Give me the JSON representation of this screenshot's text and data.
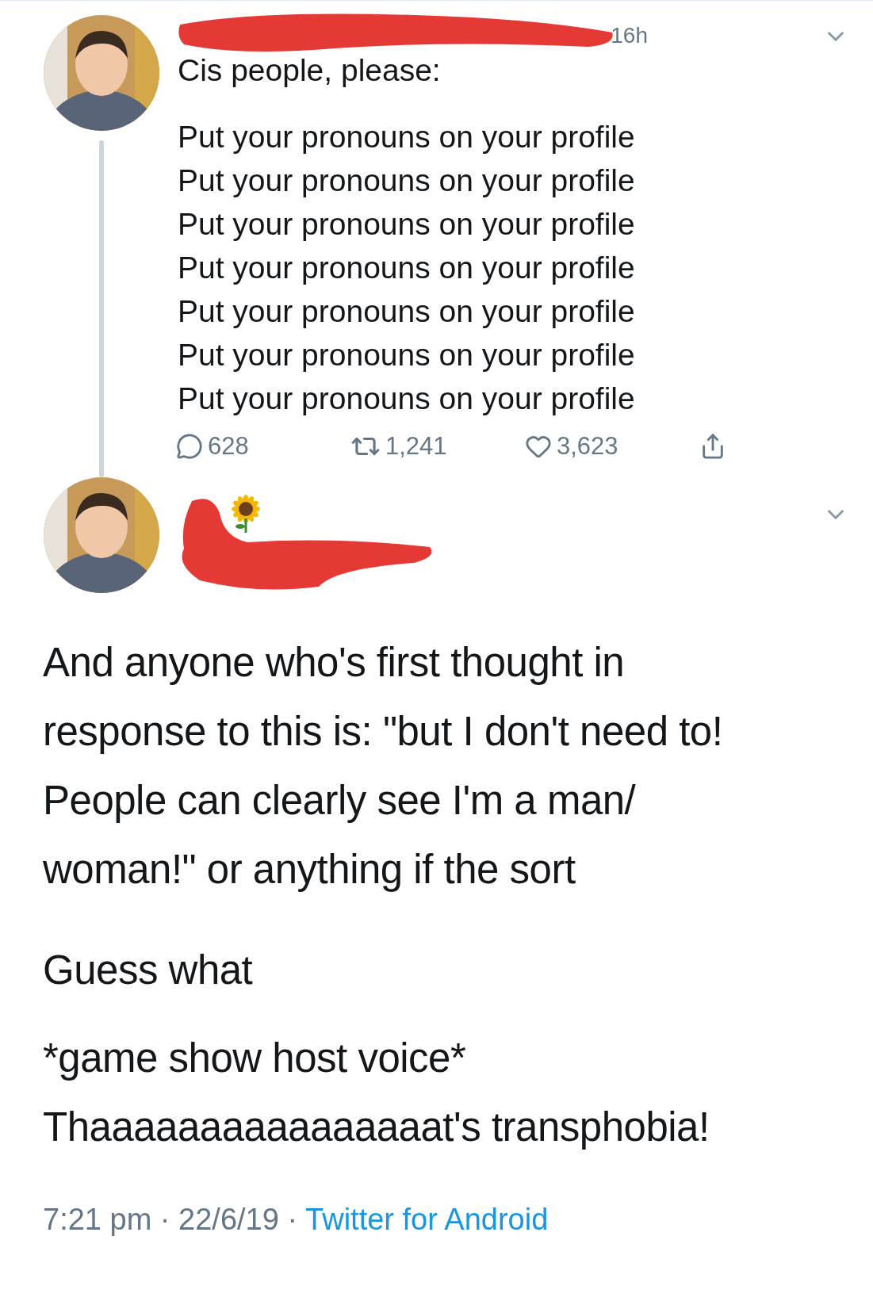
{
  "first_tweet": {
    "time": "16h",
    "intro": "Cis people, please:",
    "lines": [
      "Put your pronouns on your profile",
      "Put your pronouns on your profile",
      "Put your pronouns on your profile",
      "Put your pronouns on your profile",
      "Put your pronouns on your profile",
      "Put your pronouns on your profile",
      "Put your pronouns on your profile"
    ],
    "replies": "628",
    "retweets": "1,241",
    "likes": "3,623"
  },
  "second_tweet": {
    "paragraphs": [
      "And anyone who's first thought in response to this is: \"but I don't need to! People can clearly see I'm a man/ woman!\" or anything if the sort",
      "Guess what"
    ],
    "closing_lines": [
      "*game show host voice*",
      "Thaaaaaaaaaaaaaaaat's transphobia!"
    ],
    "timestamp": "7:21 pm · 22/6/19 ·",
    "source": "Twitter for Android"
  }
}
